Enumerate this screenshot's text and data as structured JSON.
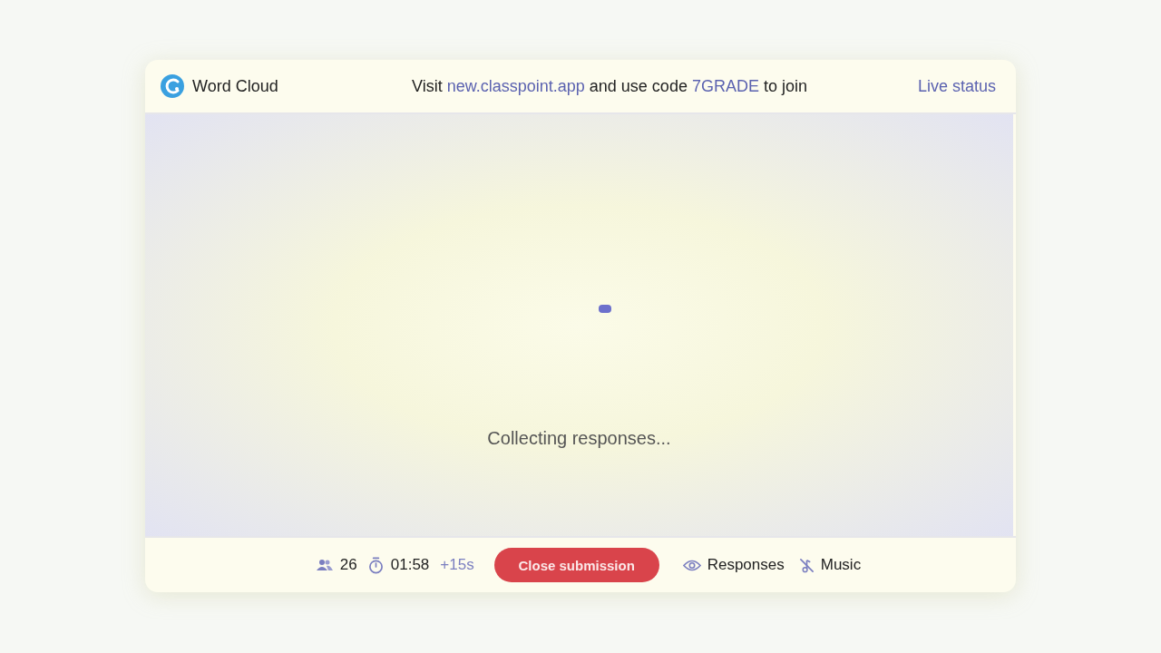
{
  "header": {
    "title": "Word Cloud",
    "join_message": [
      {
        "kind": "text",
        "text": "Visit"
      },
      {
        "kind": "link",
        "text": "new.classpoint.app"
      },
      {
        "kind": "text",
        "text": "and use code"
      },
      {
        "kind": "code",
        "text": "7GRADE"
      },
      {
        "kind": "text",
        "text": "to join"
      }
    ],
    "live_status": "Live status"
  },
  "body": {
    "status": "Collecting responses..."
  },
  "footer": {
    "participants": "26",
    "timer": "01:58",
    "extra_time": "+15s",
    "close_button": "Close submission",
    "responses_button": "Responses",
    "music_button": "Music"
  }
}
